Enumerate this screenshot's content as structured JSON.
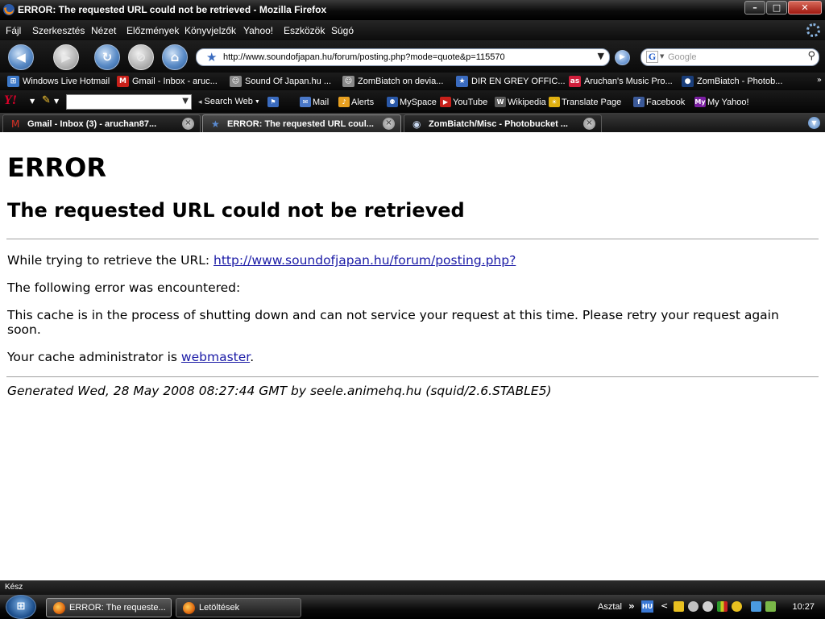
{
  "window": {
    "title": "ERROR: The requested URL could not be retrieved - Mozilla Firefox",
    "controls": [
      "–",
      "□",
      "✕"
    ]
  },
  "menu": [
    "Fájl",
    "Szerkesztés",
    "Nézet",
    "Előzmények",
    "Könyvjelzők",
    "Yahoo!",
    "Eszközök",
    "Súgó"
  ],
  "nav": {
    "url": "http://www.soundofjapan.hu/forum/posting.php?mode=quote&p=115570",
    "search_placeholder": "Google",
    "search_engine_letter": "G"
  },
  "bookmarks": [
    {
      "label": "Windows Live Hotmail",
      "icon": "windows-icon",
      "color": "#3c78c8",
      "glyph": "⊞"
    },
    {
      "label": "Gmail - Inbox - aruc...",
      "icon": "gmail-icon",
      "color": "#c8201a",
      "glyph": "M"
    },
    {
      "label": "Sound Of Japan.hu ...",
      "icon": "cat-icon",
      "color": "#8a8a8a",
      "glyph": "☺"
    },
    {
      "label": "ZomBiatch on devia...",
      "icon": "cat-icon",
      "color": "#8a8a8a",
      "glyph": "☺"
    },
    {
      "label": "DIR EN GREY OFFIC...",
      "icon": "star-icon",
      "color": "#3a6bbf",
      "glyph": "★"
    },
    {
      "label": "Aruchan's Music Pro...",
      "icon": "lastfm-icon",
      "color": "#d01f3c",
      "glyph": "as"
    },
    {
      "label": "ZomBiatch - Photob...",
      "icon": "photobucket-icon",
      "color": "#1a3e7a",
      "glyph": "●"
    }
  ],
  "yahoo": {
    "logo": "Y!",
    "search_web": "Search Web",
    "items": [
      {
        "label": "Mail",
        "icon": "mail-icon",
        "color": "#4a78c8",
        "glyph": "✉"
      },
      {
        "label": "Alerts",
        "icon": "alerts-icon",
        "color": "#e8a020",
        "glyph": "♪"
      },
      {
        "label": "MySpace",
        "icon": "myspace-icon",
        "color": "#2a58a8",
        "glyph": "⚉"
      },
      {
        "label": "YouTube",
        "icon": "youtube-icon",
        "color": "#c8201a",
        "glyph": "▶"
      },
      {
        "label": "Wikipedia",
        "icon": "wikipedia-icon",
        "color": "#5a5a5a",
        "glyph": "W"
      },
      {
        "label": "Translate Page",
        "icon": "translate-icon",
        "color": "#e0b010",
        "glyph": "☀"
      },
      {
        "label": "Facebook",
        "icon": "facebook-icon",
        "color": "#3b5998",
        "glyph": "f"
      },
      {
        "label": "My Yahoo!",
        "icon": "myyahoo-icon",
        "color": "#7b1fa2",
        "glyph": "My"
      }
    ]
  },
  "tabs": [
    {
      "label": "Gmail - Inbox (3) - aruchan87...",
      "icon": "gmail-icon",
      "active": false
    },
    {
      "label": "ERROR: The requested URL coul...",
      "icon": "star-icon",
      "active": true
    },
    {
      "label": "ZomBiatch/Misc - Photobucket ...",
      "icon": "photobucket-icon",
      "active": false
    }
  ],
  "page": {
    "h1": "ERROR",
    "h2": "The requested URL could not be retrieved",
    "trying_prefix": "While trying to retrieve the URL: ",
    "trying_url": "http://www.soundofjapan.hu/forum/posting.php?",
    "encountered": "The following error was encountered:",
    "message": "This cache is in the process of shutting down and can not service your request at this time. Please retry your request again soon.",
    "admin_prefix": "Your cache administrator is ",
    "admin_link": "webmaster",
    "admin_suffix": ".",
    "generated": "Generated Wed, 28 May 2008 08:27:44 GMT by seele.animehq.hu (squid/2.6.STABLE5)"
  },
  "status": "Kész",
  "taskbar": {
    "buttons": [
      {
        "label": "ERROR: The requeste...",
        "active": true
      },
      {
        "label": "Letöltések",
        "active": false
      }
    ],
    "desktop": "Asztal",
    "lang": "HU",
    "clock": "10:27"
  }
}
